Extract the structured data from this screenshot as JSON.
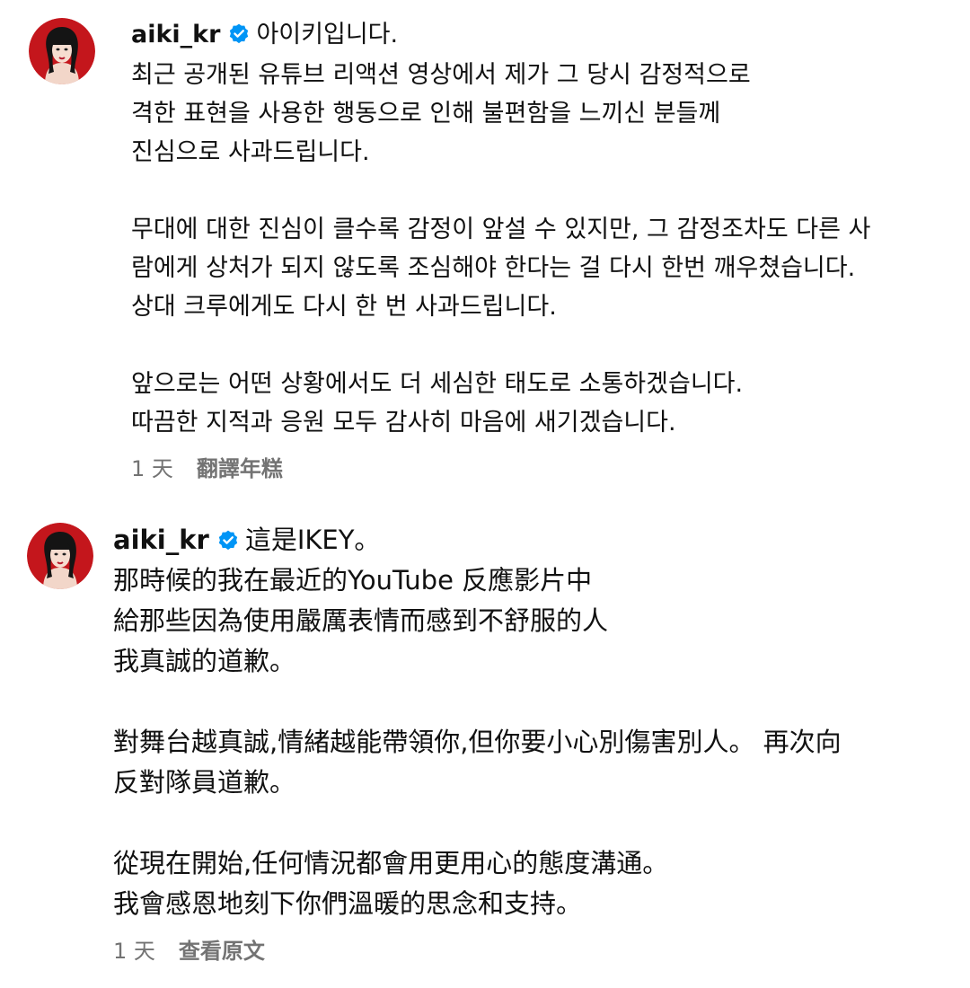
{
  "comments": [
    {
      "username": "aiki_kr",
      "verified": true,
      "header_text": "아이키입니다.",
      "lines": [
        "최근 공개된 유튜브 리액션 영상에서 제가 그 당시 감정적으로",
        "격한 표현을 사용한 행동으로 인해 불편함을 느끼신 분들께",
        "진심으로 사과드립니다.",
        "",
        "무대에 대한 진심이 클수록 감정이 앞설 수 있지만, 그 감정조차도 다른 사",
        "람에게 상처가 되지 않도록 조심해야 한다는 걸 다시 한번 깨우쳤습니다.",
        "상대 크루에게도 다시 한 번 사과드립니다.",
        "",
        "앞으로는 어떤 상황에서도 더 세심한 태도로 소통하겠습니다.",
        "따끔한 지적과 응원 모두 감사히 마음에 새기겠습니다."
      ],
      "time": "1 天",
      "action": "翻譯年糕"
    },
    {
      "username": "aiki_kr",
      "verified": true,
      "header_text": "這是IKEY。",
      "lines": [
        "那時候的我在最近的YouTube 反應影片中",
        "給那些因為使用嚴厲表情而感到不舒服的人",
        "我真誠的道歉。",
        "",
        "對舞台越真誠,情緒越能帶領你,但你要小心別傷害別人。 再次向",
        "反對隊員道歉。",
        "",
        "從現在開始,任何情況都會用更用心的態度溝通。",
        "我會感恩地刻下你們溫暖的思念和支持。"
      ],
      "time": "1 天",
      "action": "查看原文"
    }
  ],
  "icons": {
    "avatar": "avatar-illustration",
    "verified": "verified-badge-icon"
  },
  "colors": {
    "verified": "#0095f6",
    "meta": "#737373",
    "avatar_bg": "#c4161c"
  }
}
